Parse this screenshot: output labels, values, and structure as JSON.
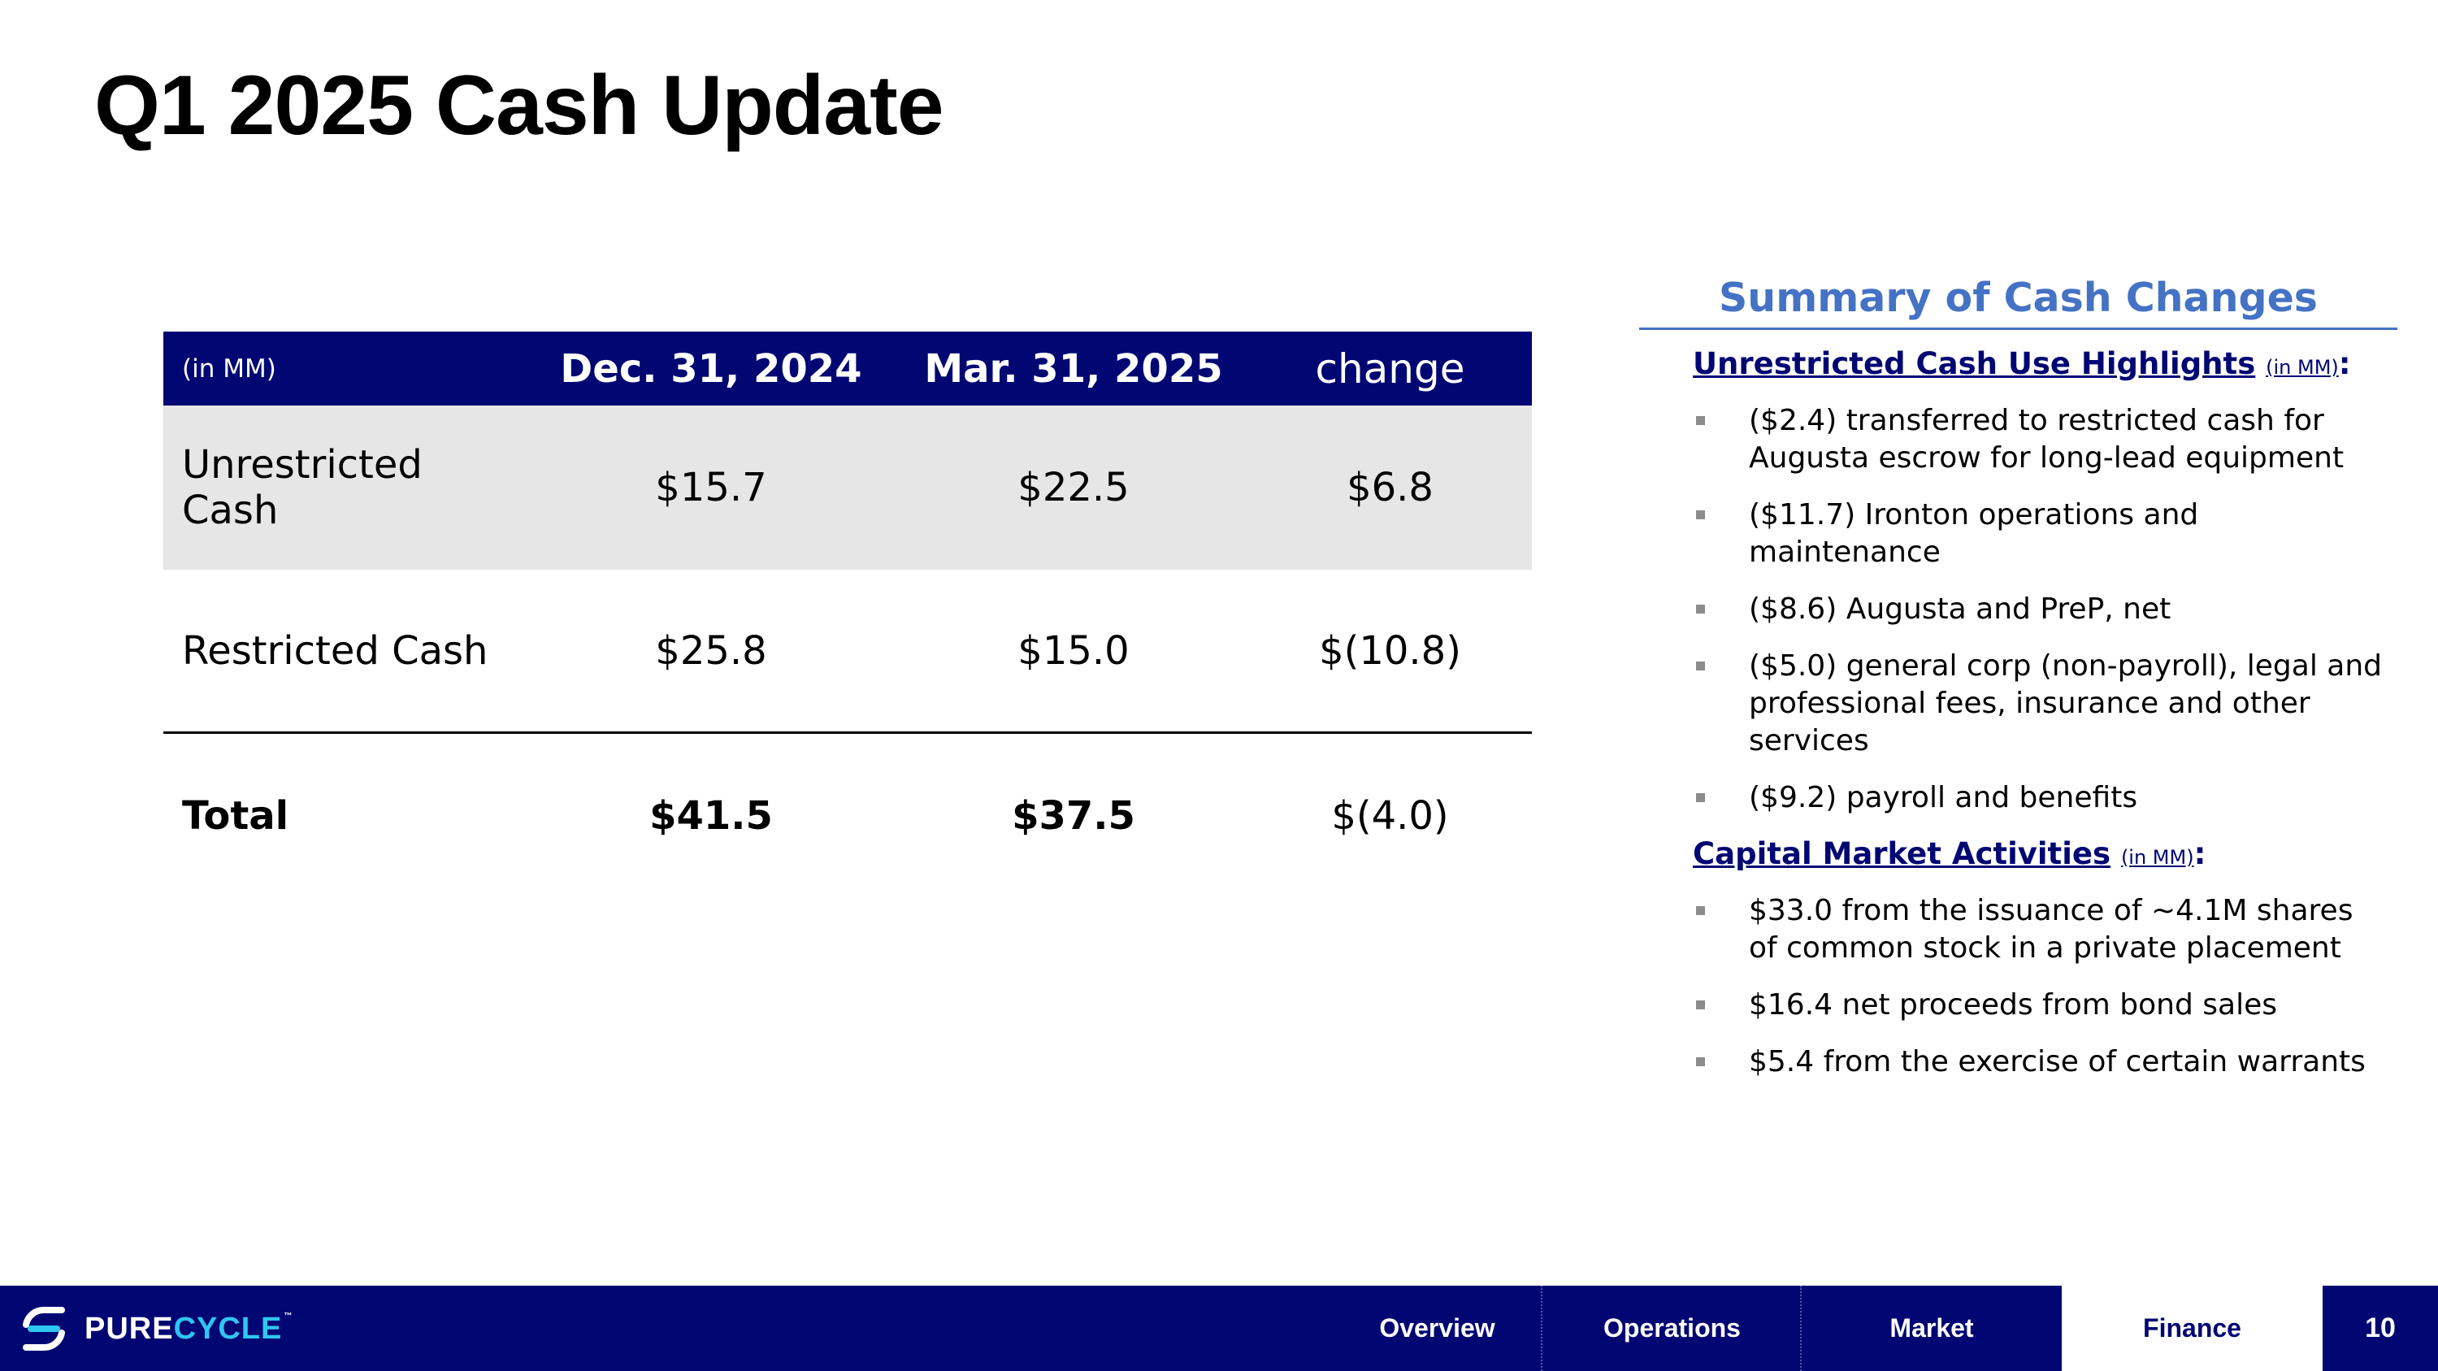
{
  "title": "Q1 2025 Cash Update",
  "table": {
    "unit_label": "(in MM)",
    "columns": [
      "Dec. 31, 2024",
      "Mar. 31, 2025",
      "change"
    ],
    "rows": [
      {
        "label": "Unrestricted Cash",
        "values": [
          "$15.7",
          "$22.5",
          "$6.8"
        ]
      },
      {
        "label": "Restricted Cash",
        "values": [
          "$25.8",
          "$15.0",
          "$(10.8)"
        ]
      },
      {
        "label": "Total",
        "values": [
          "$41.5",
          "$37.5",
          "$(4.0)"
        ]
      }
    ]
  },
  "summary": {
    "title": "Summary of Cash Changes",
    "sections": [
      {
        "heading": "Unrestricted Cash Use Highlights",
        "unit": "(in MM)",
        "colon": ":",
        "items": [
          "($2.4) transferred to restricted cash for Augusta escrow for long-lead equipment",
          "($11.7) Ironton operations and maintenance",
          "($8.6) Augusta and PreP, net",
          "($5.0) general corp (non-payroll), legal and professional fees, insurance and other services",
          "($9.2) payroll and benefits"
        ]
      },
      {
        "heading": "Capital Market Activities",
        "unit": "(in MM)",
        "colon": ":",
        "items": [
          "$33.0 from the issuance of ~4.1M shares of common stock in a private placement",
          "$16.4 net proceeds from bond sales",
          "$5.4 from the exercise of certain warrants"
        ]
      }
    ]
  },
  "footer": {
    "logo_part1": "PURE",
    "logo_part2": "CYCLE",
    "logo_tm": "™",
    "nav": [
      "Overview",
      "Operations",
      "Market",
      "Finance"
    ],
    "active_nav": "Finance",
    "page_number": "10"
  },
  "colors": {
    "navy": "#000773",
    "accent_blue": "#4472c4",
    "logo_cyan": "#2fc6f0",
    "row_shade": "#e6e6e6"
  }
}
